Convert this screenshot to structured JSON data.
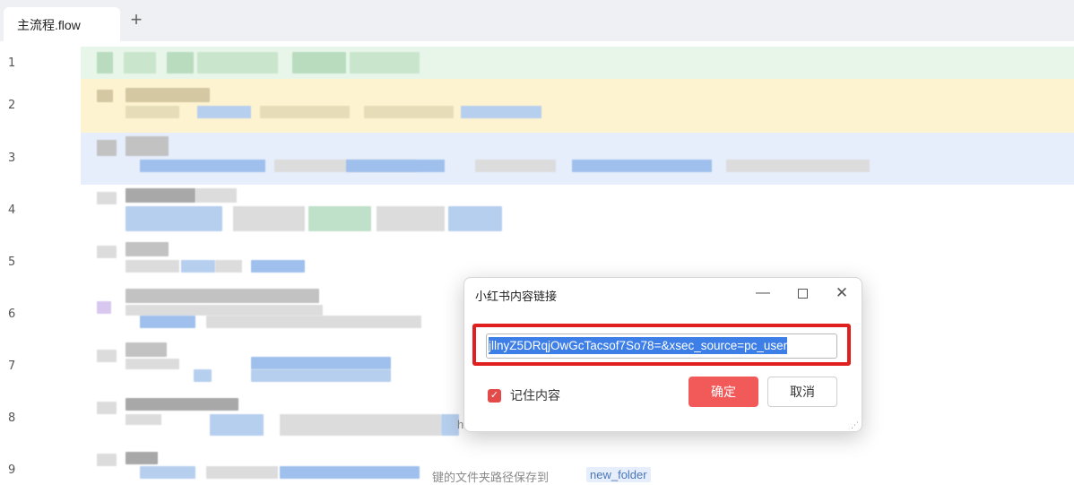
{
  "tabs": [
    {
      "label": "主流程.flow"
    }
  ],
  "tab_add_label": "+",
  "line_numbers": [
    "1",
    "2",
    "3",
    "4",
    "5",
    "6",
    "7",
    "8",
    "9"
  ],
  "editor_fragments": {
    "line8_fragment": "h",
    "line9_text": "键的文件夹路径保存到",
    "line9_chip": "new_folder"
  },
  "dialog": {
    "title": "小红书内容链接",
    "url_value": "jllnyZ5DRqjOwGcTacsof7So78=&xsec_source=pc_user",
    "remember_label": "记住内容",
    "remember_checked": true,
    "confirm_label": "确定",
    "cancel_label": "取消",
    "minimize_icon": "minimize-icon",
    "maximize_icon": "maximize-icon",
    "close_icon": "close-icon"
  },
  "colors": {
    "accent_red": "#f25a5a",
    "highlight_border": "#e01f1f",
    "selection": "#3d7fe6",
    "row1_bg": "#e8f6ea",
    "row2_bg": "#fdf3d0",
    "row3_bg": "#e6eefb"
  }
}
